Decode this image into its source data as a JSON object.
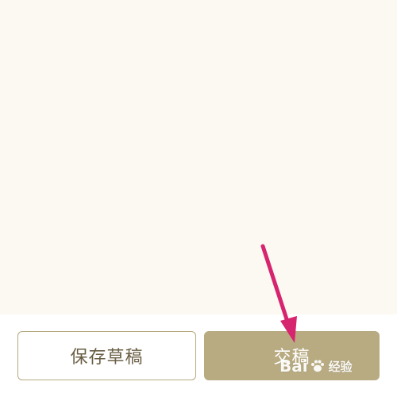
{
  "editor": {
    "background_color": "#fcf9f2"
  },
  "actions": {
    "save_draft_label": "保存草稿",
    "submit_label": "交稿",
    "accent_color": "#b8ab82"
  },
  "annotation": {
    "arrow_color": "#d6246e",
    "arrow_icon": "arrow-down-right-icon"
  },
  "watermark": {
    "brand_prefix": "Bai",
    "brand_suffix": "经验",
    "logo_icon": "paw-icon"
  }
}
